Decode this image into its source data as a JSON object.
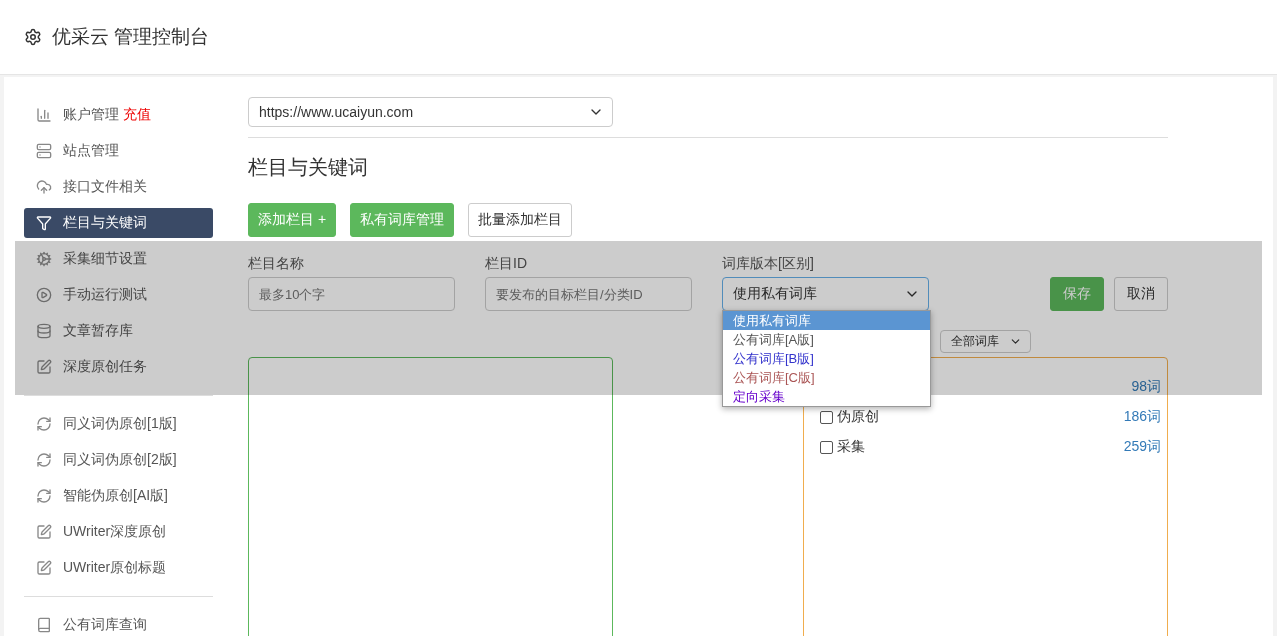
{
  "header": {
    "title": "优采云 管理控制台"
  },
  "sidebar": {
    "groups": [
      [
        {
          "kind": "chart",
          "label": "账户管理",
          "badge": "充值",
          "selected": false
        },
        {
          "kind": "server",
          "label": "站点管理",
          "selected": false
        },
        {
          "kind": "cloud",
          "label": "接口文件相关",
          "selected": false
        },
        {
          "kind": "filter",
          "label": "栏目与关键词",
          "selected": true
        },
        {
          "kind": "cogs",
          "label": "采集细节设置",
          "selected": false
        },
        {
          "kind": "play",
          "label": "手动运行测试",
          "selected": false
        },
        {
          "kind": "database",
          "label": "文章暂存库",
          "selected": false
        },
        {
          "kind": "edit",
          "label": "深度原创任务",
          "selected": false
        }
      ],
      [
        {
          "kind": "refresh",
          "label": "同义词伪原创[1版]",
          "selected": false
        },
        {
          "kind": "refresh",
          "label": "同义词伪原创[2版]",
          "selected": false
        },
        {
          "kind": "refresh",
          "label": "智能伪原创[AI版]",
          "selected": false
        },
        {
          "kind": "edit",
          "label": "UWriter深度原创",
          "selected": false
        },
        {
          "kind": "edit",
          "label": "UWriter原创标题",
          "selected": false
        }
      ],
      [
        {
          "kind": "book",
          "label": "公有词库查询",
          "selected": false
        }
      ]
    ]
  },
  "site_select": {
    "value": "https://www.ucaiyun.com"
  },
  "section_title": "栏目与关键词",
  "action_buttons": [
    {
      "label": "添加栏目 +",
      "kind": "primary"
    },
    {
      "label": "私有词库管理",
      "kind": "primary"
    },
    {
      "label": "批量添加栏目",
      "kind": "default"
    }
  ],
  "form": {
    "fields": [
      {
        "label": "栏目名称",
        "placeholder": "最多10个字"
      },
      {
        "label": "栏目ID",
        "placeholder": "要发布的目标栏目/分类ID"
      }
    ],
    "library_select": {
      "label": "词库版本[区别]",
      "value": "使用私有词库",
      "expanded": true,
      "options": [
        {
          "label": "使用私有词库",
          "selected": true
        },
        {
          "label": "公有词库[A版]",
          "selected": false,
          "color": "#555555"
        },
        {
          "label": "公有词库[B版]",
          "selected": false,
          "color": "#3333cc"
        },
        {
          "label": "公有词库[C版]",
          "selected": false,
          "color": "#aa5555"
        },
        {
          "label": "定向采集",
          "selected": false,
          "color": "#6600cc"
        }
      ]
    },
    "buttons": [
      {
        "label": "保存",
        "kind": "primary"
      },
      {
        "label": "取消",
        "kind": "default"
      }
    ]
  },
  "library_filter": {
    "value": "全部词库"
  },
  "libraries": [
    {
      "count": "98词"
    },
    {
      "label": "伪原创",
      "checked": false,
      "count": "186词"
    },
    {
      "label": "采集",
      "checked": false,
      "count": "259词"
    }
  ]
}
